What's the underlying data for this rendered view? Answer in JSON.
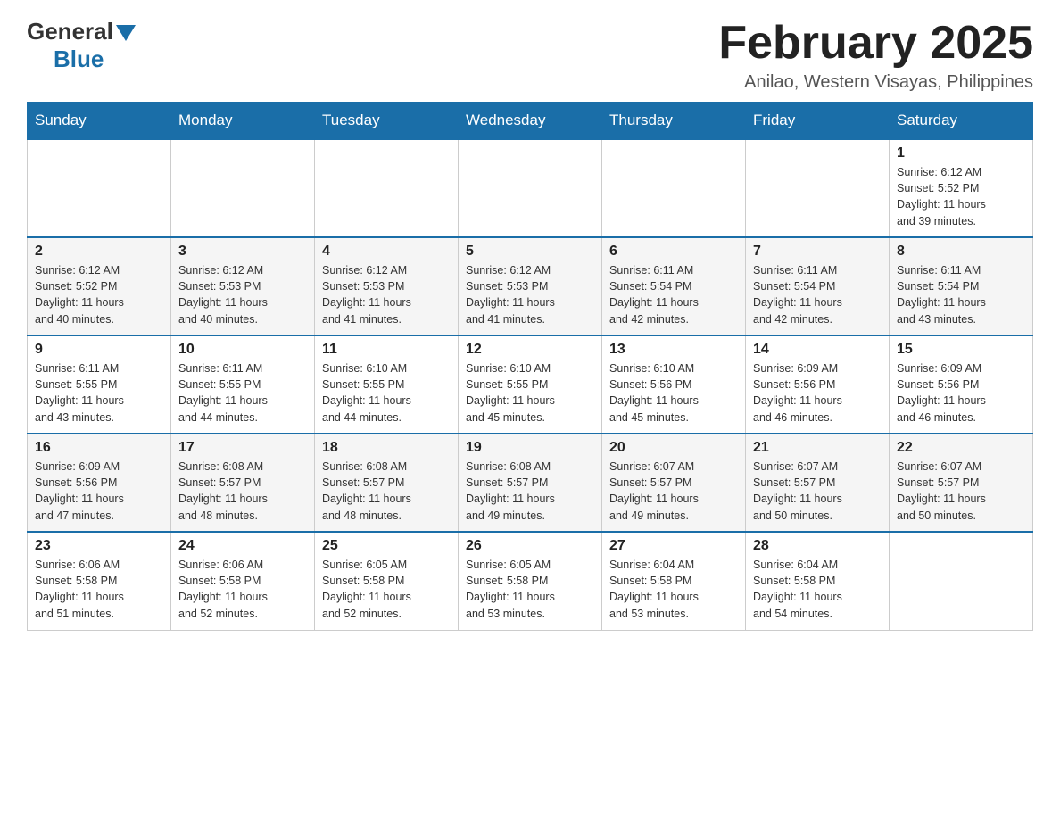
{
  "header": {
    "logo_general": "General",
    "logo_blue": "Blue",
    "title": "February 2025",
    "subtitle": "Anilao, Western Visayas, Philippines"
  },
  "days_of_week": [
    "Sunday",
    "Monday",
    "Tuesday",
    "Wednesday",
    "Thursday",
    "Friday",
    "Saturday"
  ],
  "weeks": [
    [
      {
        "day": "",
        "info": ""
      },
      {
        "day": "",
        "info": ""
      },
      {
        "day": "",
        "info": ""
      },
      {
        "day": "",
        "info": ""
      },
      {
        "day": "",
        "info": ""
      },
      {
        "day": "",
        "info": ""
      },
      {
        "day": "1",
        "info": "Sunrise: 6:12 AM\nSunset: 5:52 PM\nDaylight: 11 hours\nand 39 minutes."
      }
    ],
    [
      {
        "day": "2",
        "info": "Sunrise: 6:12 AM\nSunset: 5:52 PM\nDaylight: 11 hours\nand 40 minutes."
      },
      {
        "day": "3",
        "info": "Sunrise: 6:12 AM\nSunset: 5:53 PM\nDaylight: 11 hours\nand 40 minutes."
      },
      {
        "day": "4",
        "info": "Sunrise: 6:12 AM\nSunset: 5:53 PM\nDaylight: 11 hours\nand 41 minutes."
      },
      {
        "day": "5",
        "info": "Sunrise: 6:12 AM\nSunset: 5:53 PM\nDaylight: 11 hours\nand 41 minutes."
      },
      {
        "day": "6",
        "info": "Sunrise: 6:11 AM\nSunset: 5:54 PM\nDaylight: 11 hours\nand 42 minutes."
      },
      {
        "day": "7",
        "info": "Sunrise: 6:11 AM\nSunset: 5:54 PM\nDaylight: 11 hours\nand 42 minutes."
      },
      {
        "day": "8",
        "info": "Sunrise: 6:11 AM\nSunset: 5:54 PM\nDaylight: 11 hours\nand 43 minutes."
      }
    ],
    [
      {
        "day": "9",
        "info": "Sunrise: 6:11 AM\nSunset: 5:55 PM\nDaylight: 11 hours\nand 43 minutes."
      },
      {
        "day": "10",
        "info": "Sunrise: 6:11 AM\nSunset: 5:55 PM\nDaylight: 11 hours\nand 44 minutes."
      },
      {
        "day": "11",
        "info": "Sunrise: 6:10 AM\nSunset: 5:55 PM\nDaylight: 11 hours\nand 44 minutes."
      },
      {
        "day": "12",
        "info": "Sunrise: 6:10 AM\nSunset: 5:55 PM\nDaylight: 11 hours\nand 45 minutes."
      },
      {
        "day": "13",
        "info": "Sunrise: 6:10 AM\nSunset: 5:56 PM\nDaylight: 11 hours\nand 45 minutes."
      },
      {
        "day": "14",
        "info": "Sunrise: 6:09 AM\nSunset: 5:56 PM\nDaylight: 11 hours\nand 46 minutes."
      },
      {
        "day": "15",
        "info": "Sunrise: 6:09 AM\nSunset: 5:56 PM\nDaylight: 11 hours\nand 46 minutes."
      }
    ],
    [
      {
        "day": "16",
        "info": "Sunrise: 6:09 AM\nSunset: 5:56 PM\nDaylight: 11 hours\nand 47 minutes."
      },
      {
        "day": "17",
        "info": "Sunrise: 6:08 AM\nSunset: 5:57 PM\nDaylight: 11 hours\nand 48 minutes."
      },
      {
        "day": "18",
        "info": "Sunrise: 6:08 AM\nSunset: 5:57 PM\nDaylight: 11 hours\nand 48 minutes."
      },
      {
        "day": "19",
        "info": "Sunrise: 6:08 AM\nSunset: 5:57 PM\nDaylight: 11 hours\nand 49 minutes."
      },
      {
        "day": "20",
        "info": "Sunrise: 6:07 AM\nSunset: 5:57 PM\nDaylight: 11 hours\nand 49 minutes."
      },
      {
        "day": "21",
        "info": "Sunrise: 6:07 AM\nSunset: 5:57 PM\nDaylight: 11 hours\nand 50 minutes."
      },
      {
        "day": "22",
        "info": "Sunrise: 6:07 AM\nSunset: 5:57 PM\nDaylight: 11 hours\nand 50 minutes."
      }
    ],
    [
      {
        "day": "23",
        "info": "Sunrise: 6:06 AM\nSunset: 5:58 PM\nDaylight: 11 hours\nand 51 minutes."
      },
      {
        "day": "24",
        "info": "Sunrise: 6:06 AM\nSunset: 5:58 PM\nDaylight: 11 hours\nand 52 minutes."
      },
      {
        "day": "25",
        "info": "Sunrise: 6:05 AM\nSunset: 5:58 PM\nDaylight: 11 hours\nand 52 minutes."
      },
      {
        "day": "26",
        "info": "Sunrise: 6:05 AM\nSunset: 5:58 PM\nDaylight: 11 hours\nand 53 minutes."
      },
      {
        "day": "27",
        "info": "Sunrise: 6:04 AM\nSunset: 5:58 PM\nDaylight: 11 hours\nand 53 minutes."
      },
      {
        "day": "28",
        "info": "Sunrise: 6:04 AM\nSunset: 5:58 PM\nDaylight: 11 hours\nand 54 minutes."
      },
      {
        "day": "",
        "info": ""
      }
    ]
  ]
}
